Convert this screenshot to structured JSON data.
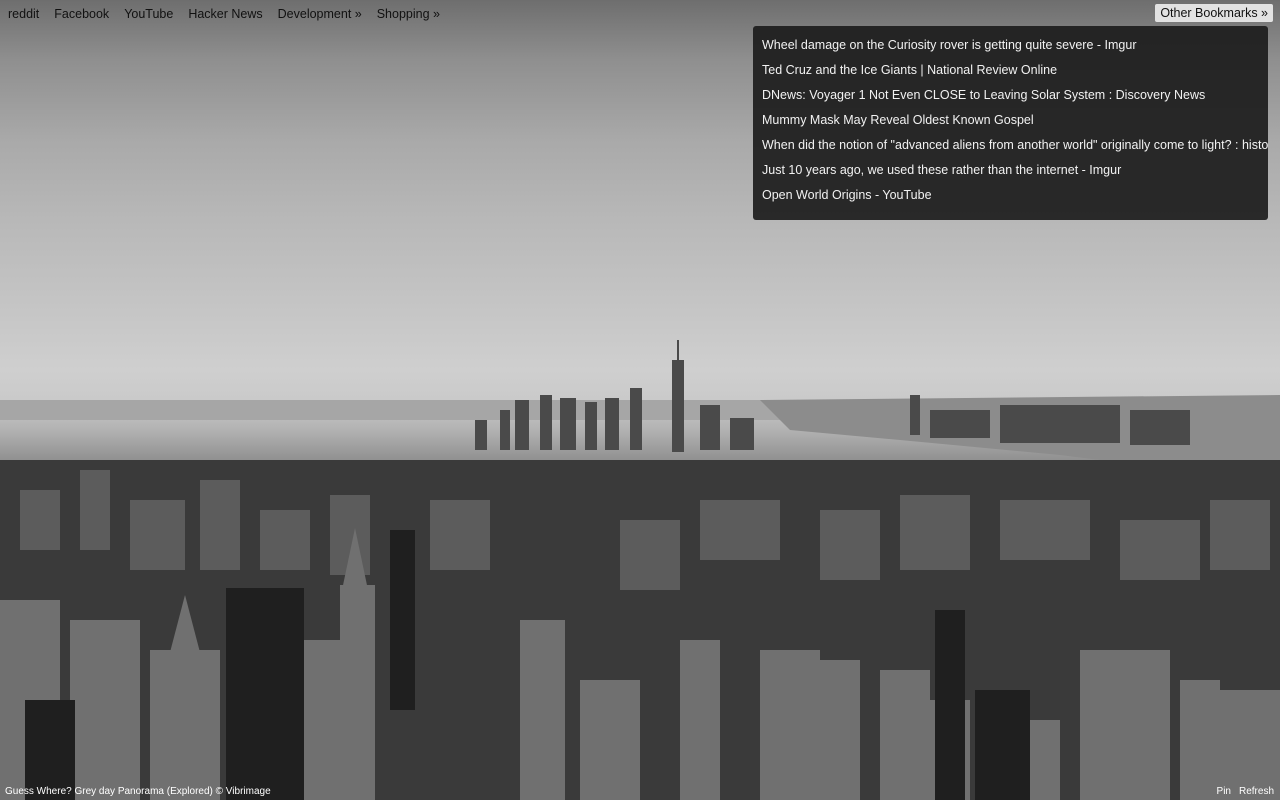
{
  "bookmarks_bar": {
    "items": [
      "reddit",
      "Facebook",
      "YouTube",
      "Hacker News",
      "Development »",
      "Shopping »"
    ],
    "other_label": "Other Bookmarks »"
  },
  "dropdown": {
    "items": [
      "Wheel damage on the Curiosity rover is getting quite severe - Imgur",
      "Ted Cruz and the Ice Giants | National Review Online",
      "DNews: Voyager 1 Not Even CLOSE to Leaving Solar System : Discovery News",
      "Mummy Mask May Reveal Oldest Known Gospel",
      "When did the notion of \"advanced aliens from another world\" originally come to light? : history",
      "Just 10 years ago, we used these rather than the internet - Imgur",
      "Open World Origins - YouTube"
    ]
  },
  "footer": {
    "credit": "Guess Where? Grey day Panorama (Explored) © Vibrimage",
    "pin_label": "Pin",
    "refresh_label": "Refresh"
  }
}
